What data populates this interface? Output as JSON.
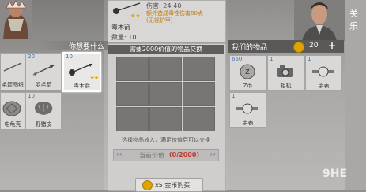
{
  "left": {
    "title": "你想要什么",
    "items": [
      {
        "count": "",
        "name": "毛箭图纸"
      },
      {
        "count": "20",
        "name": "羽毛箭"
      },
      {
        "count": "10",
        "name": "毒木箭"
      },
      {
        "count": "",
        "name": "电龟壳"
      },
      {
        "count": "10",
        "name": "野猪皮"
      }
    ]
  },
  "detail": {
    "stat1": "伤害: 24-40",
    "stat2": "额外造成毒性伤害80点",
    "stat3": "(无视护甲)",
    "name": "毒木箭",
    "qty": "数量: 10"
  },
  "trade": {
    "header": "需要2000价值的物品交换",
    "hint": "选择物品放入，满足价值后可以交换",
    "value_label": "当前价值",
    "value_amount": "(0/2000)",
    "buy_label": "x5 金币购买"
  },
  "right": {
    "title": "我们的物品",
    "coins": "20",
    "plus": "+",
    "items": [
      {
        "count": "650",
        "name": "Z币"
      },
      {
        "count": "1",
        "name": "相机"
      },
      {
        "count": "1",
        "name": "手表"
      },
      {
        "count": "1",
        "name": "手表"
      }
    ]
  },
  "watermark": "9HE",
  "side_text": "关\n乐"
}
